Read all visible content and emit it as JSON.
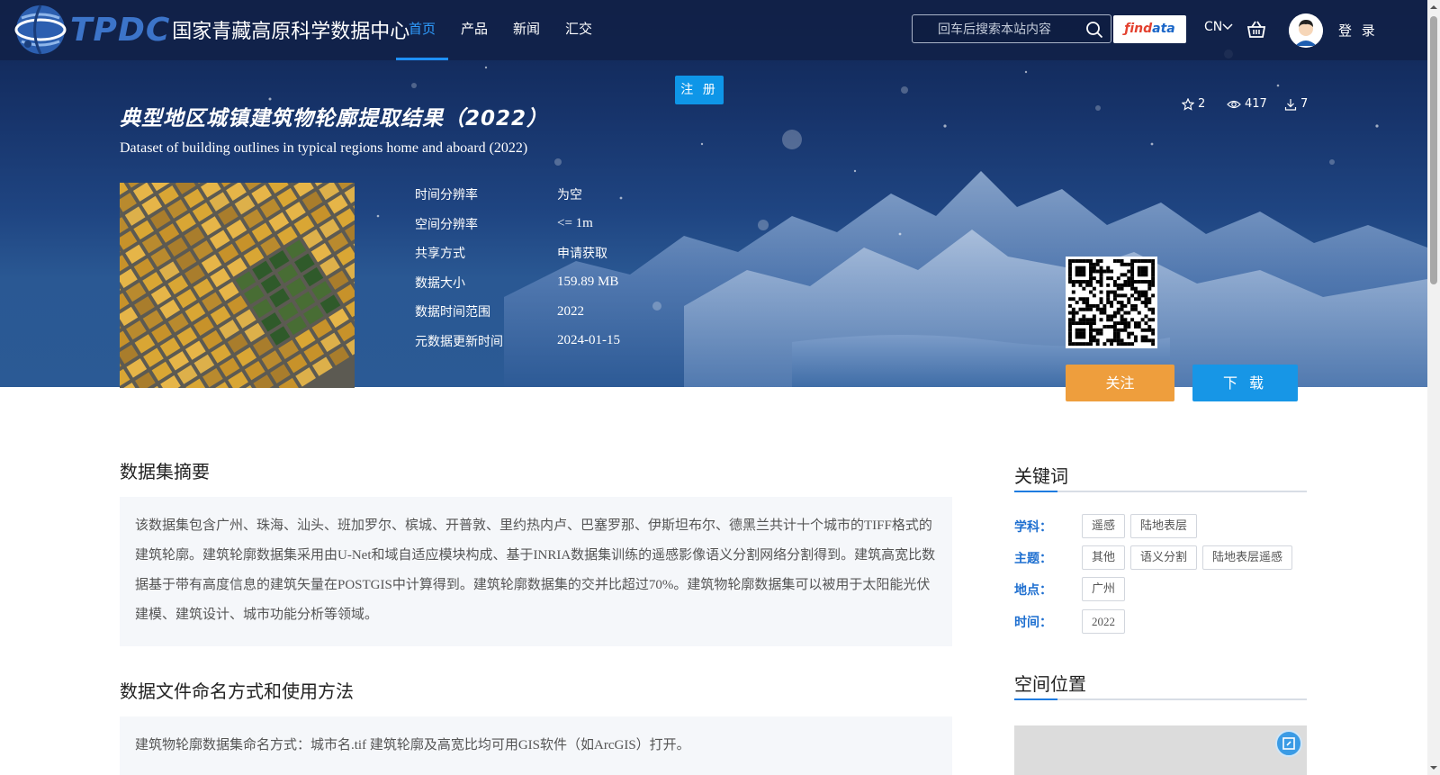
{
  "header": {
    "logo_abbr": "TPDC",
    "logo_name": "国家青藏高原科学数据中心",
    "nav": [
      {
        "label": "首页",
        "active": true
      },
      {
        "label": "产品",
        "active": false
      },
      {
        "label": "新闻",
        "active": false
      },
      {
        "label": "汇交",
        "active": false
      }
    ],
    "search_placeholder": "回车后搜索本站内容",
    "findata_left": "ƒind",
    "findata_right": "ata",
    "lang": "CN",
    "login": "登 录"
  },
  "register_label": "注 册",
  "dataset": {
    "title_cn": "典型地区城镇建筑物轮廓提取结果（2022）",
    "title_en": "Dataset of building outlines in typical regions home and aboard (2022)",
    "stars": "2",
    "views": "417",
    "downloads": "7",
    "meta": [
      {
        "key": "时间分辨率",
        "value": "为空"
      },
      {
        "key": "空间分辨率",
        "value": "<= 1m"
      },
      {
        "key": "共享方式",
        "value": "申请获取"
      },
      {
        "key": "数据大小",
        "value": "159.89 MB"
      },
      {
        "key": "数据时间范围",
        "value": "2022"
      },
      {
        "key": "元数据更新时间",
        "value": "2024-01-15"
      }
    ],
    "follow_label": "关注",
    "download_label": "下 载"
  },
  "abstract": {
    "title": "数据集摘要",
    "lines": [
      "该数据集包含广州、珠海、汕头、班加罗尔、槟城、开普敦、里约热内卢、巴塞罗那、伊斯坦布尔、德黑兰共计十个城市的TIFF格式的",
      "建筑轮廓。建筑轮廓数据集采用由U-Net和域自适应模块构成、基于INRIA数据集训练的遥感影像语义分割网络分割得到。建筑高宽比数",
      "据基于带有高度信息的建筑矢量在POSTGIS中计算得到。建筑轮廓数据集的交并比超过70%。建筑物轮廓数据集可以被用于太阳能光伏",
      "建模、建筑设计、城市功能分析等领域。"
    ]
  },
  "naming": {
    "title": "数据文件命名方式和使用方法",
    "text": "建筑物轮廓数据集命名方式：城市名.tif 建筑轮廓及高宽比均可用GIS软件（如ArcGIS）打开。"
  },
  "keywords": {
    "title": "关键词",
    "rows": [
      {
        "label": "学科：",
        "tags": [
          "遥感",
          "陆地表层"
        ]
      },
      {
        "label": "主题：",
        "tags": [
          "其他",
          "语义分割",
          "陆地表层遥感"
        ]
      },
      {
        "label": "地点：",
        "tags": [
          "广州"
        ]
      },
      {
        "label": "时间：",
        "tags": [
          "2022"
        ]
      }
    ]
  },
  "spatial": {
    "title": "空间位置"
  },
  "colors": {
    "accent": "#1e90ff",
    "follow": "#ee9e3d",
    "download": "#1796e6",
    "keyword_label": "#1e6fd0"
  }
}
